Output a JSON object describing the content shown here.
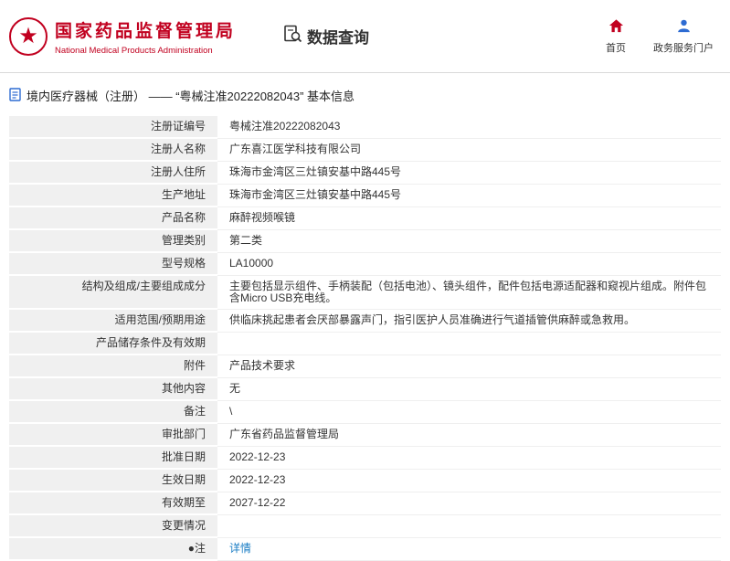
{
  "header": {
    "title": "国家药品监督管理局",
    "subtitle": "National Medical Products Administration",
    "data_query_label": "数据查询",
    "nav": [
      {
        "label": "首页",
        "icon": "home-icon"
      },
      {
        "label": "政务服务门户",
        "icon": "person-icon"
      }
    ]
  },
  "breadcrumb": {
    "text": "境内医疗器械（注册）  ——  “粤械注准20222082043”  基本信息"
  },
  "table": {
    "rows": [
      {
        "label": "注册证编号",
        "value": "粤械注准20222082043"
      },
      {
        "label": "注册人名称",
        "value": "广东喜江医学科技有限公司"
      },
      {
        "label": "注册人住所",
        "value": "珠海市金湾区三灶镇安基中路445号"
      },
      {
        "label": "生产地址",
        "value": "珠海市金湾区三灶镇安基中路445号"
      },
      {
        "label": "产品名称",
        "value": "麻醉视频喉镜"
      },
      {
        "label": "管理类别",
        "value": "第二类"
      },
      {
        "label": "型号规格",
        "value": "LA10000"
      },
      {
        "label": "结构及组成/主要组成成分",
        "value": "主要包括显示组件、手柄装配（包括电池）、镜头组件，配件包括电源适配器和窥视片组成。附件包含Micro USB充电线。"
      },
      {
        "label": "适用范围/预期用途",
        "value": "供临床挑起患者会厌部暴露声门，指引医护人员准确进行气道插管供麻醉或急救用。"
      },
      {
        "label": "产品储存条件及有效期",
        "value": ""
      },
      {
        "label": "附件",
        "value": "产品技术要求"
      },
      {
        "label": "其他内容",
        "value": "无"
      },
      {
        "label": "备注",
        "value": "\\"
      },
      {
        "label": "审批部门",
        "value": "广东省药品监督管理局"
      },
      {
        "label": "批准日期",
        "value": "2022-12-23"
      },
      {
        "label": "生效日期",
        "value": "2022-12-23"
      },
      {
        "label": "有效期至",
        "value": "2027-12-22"
      },
      {
        "label": "变更情况",
        "value": ""
      },
      {
        "label": "●注",
        "value": "详情",
        "link": true
      }
    ]
  },
  "colors": {
    "brand_red": "#c1001f",
    "nav_blue": "#2d6bd2",
    "link_blue": "#1a7dc4"
  }
}
